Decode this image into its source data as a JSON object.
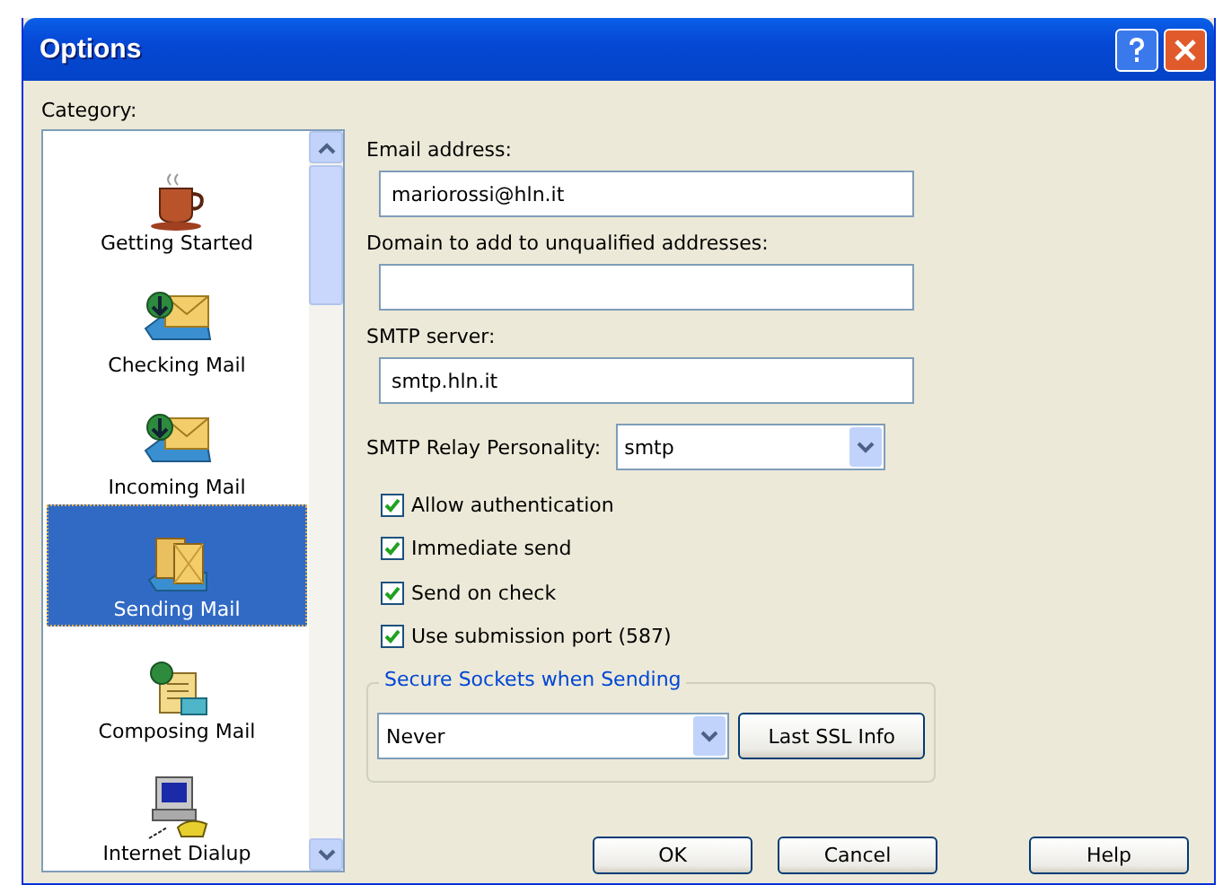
{
  "window": {
    "title": "Options"
  },
  "category": {
    "label": "Category:",
    "items": [
      {
        "label": "Getting Started",
        "kind": "cup",
        "selected": false
      },
      {
        "label": "Checking Mail",
        "kind": "inbox",
        "selected": false
      },
      {
        "label": "Incoming Mail",
        "kind": "inbox",
        "selected": false
      },
      {
        "label": "Sending Mail",
        "kind": "outbox",
        "selected": true
      },
      {
        "label": "Composing Mail",
        "kind": "compose",
        "selected": false
      },
      {
        "label": "Internet Dialup",
        "kind": "computer",
        "selected": false
      }
    ]
  },
  "fields": [
    {
      "label": "Email address:",
      "value": "mariorossi@hln.it"
    },
    {
      "label": "Domain to add to unqualified addresses:"
    },
    {
      "label": "SMTP server:",
      "value": "smtp.hln.it"
    }
  ],
  "relay": {
    "label": "SMTP Relay Personality:",
    "value": "smtp"
  },
  "checkboxes": [
    {
      "label": "Allow authentication",
      "checked": true
    },
    {
      "label": "Immediate send",
      "checked": true
    },
    {
      "label": "Send on check",
      "checked": true
    },
    {
      "label": "Use submission port (587)",
      "checked": true
    }
  ],
  "ssl": {
    "legend": "Secure Sockets when Sending",
    "value": "Never",
    "button": "Last SSL Info"
  },
  "buttons": [
    "OK",
    "Cancel",
    "Help"
  ]
}
